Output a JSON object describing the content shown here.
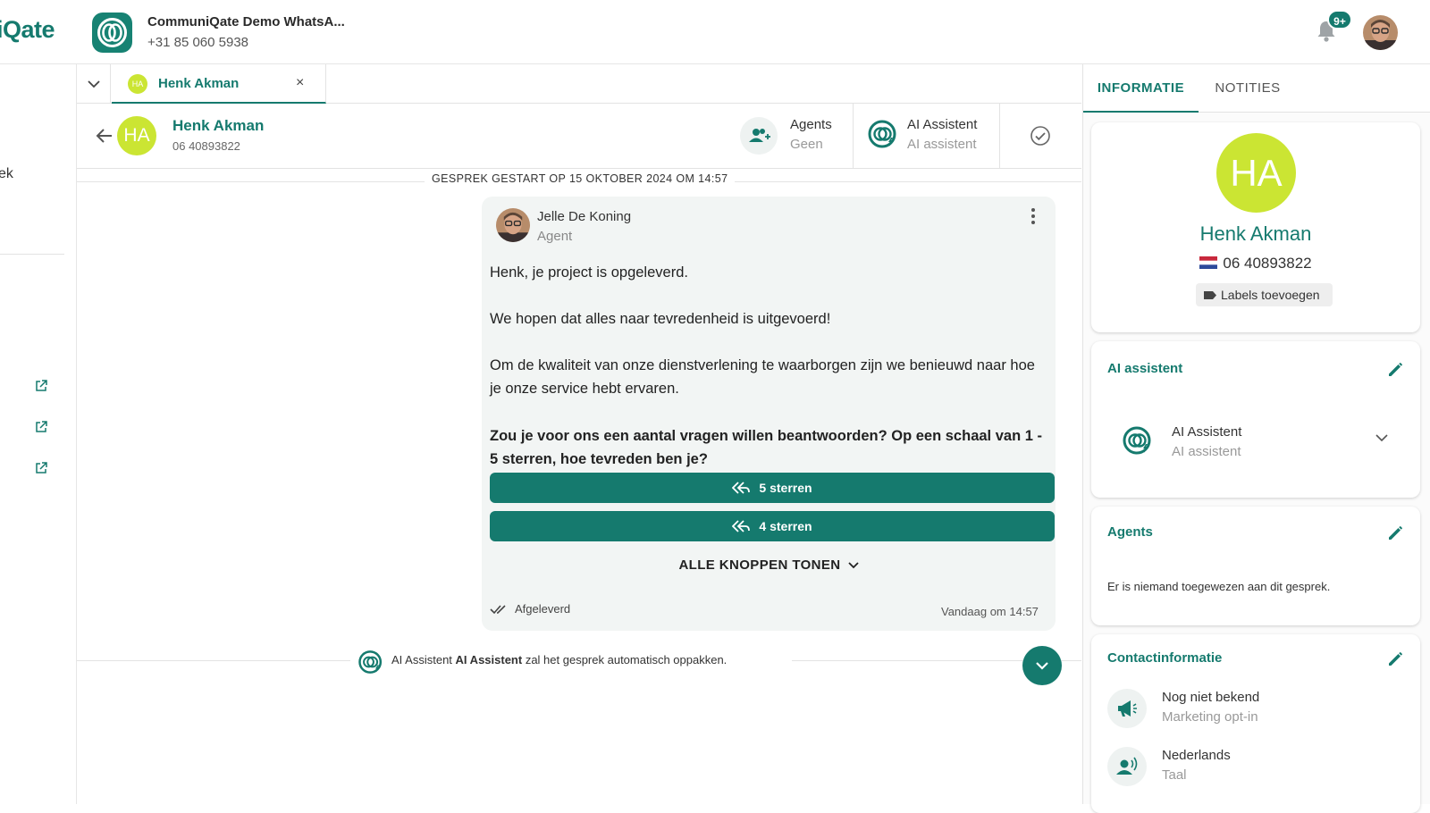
{
  "app": {
    "brand": "iQate"
  },
  "channel": {
    "name": "CommuniQate Demo WhatsA...",
    "phone": "+31 85 060 5938"
  },
  "notifications": {
    "badge": "9+"
  },
  "sidebar": {
    "partial_label": "ek"
  },
  "tabs": {
    "open_conversation": "Henk Akman",
    "close_symbol": "×",
    "mini_avatar": "HA"
  },
  "conversation": {
    "avatar": "HA",
    "name": "Henk Akman",
    "phone": "06 40893822",
    "agents_title": "Agents",
    "agents_value": "Geen",
    "ai_title": "AI Assistent",
    "ai_value": "AI assistent",
    "started": "GESPREK GESTART OP 15 OKTOBER 2024 OM 14:57"
  },
  "message": {
    "sender": "Jelle De Koning",
    "role": "Agent",
    "paragraphs": [
      "Henk, je project is opgeleverd.",
      "We hopen dat alles naar tevredenheid is uitgevoerd!",
      "Om de kwaliteit van onze dienstverlening te waarborgen zijn we benieuwd naar hoe je onze service hebt ervaren."
    ],
    "question": "Zou je voor ons een aantal vragen willen beantwoorden? Op een schaal van 1 - 5 sterren, hoe tevreden ben je?",
    "buttons": [
      "5 sterren",
      "4 sterren"
    ],
    "show_all": "ALLE KNOPPEN TONEN",
    "status": "Afgeleverd",
    "time": "Vandaag om 14:57"
  },
  "system_message": {
    "prefix": "AI Assistent",
    "bold": "AI Assistent",
    "suffix": "zal het gesprek automatisch oppakken."
  },
  "panel": {
    "tabs": [
      "INFORMATIE",
      "NOTITIES"
    ],
    "profile": {
      "avatar": "HA",
      "name": "Henk Akman",
      "phone": "06 40893822",
      "labels_button": "Labels toevoegen"
    },
    "ai_card": {
      "title": "AI assistent",
      "name": "AI Assistent",
      "sub": "AI assistent"
    },
    "agents_card": {
      "title": "Agents",
      "empty": "Er is niemand toegewezen aan dit gesprek."
    },
    "contact_card": {
      "title": "Contactinformatie",
      "items": [
        {
          "value": "Nog niet bekend",
          "label": "Marketing opt-in",
          "icon": "megaphone-icon"
        },
        {
          "value": "Nederlands",
          "label": "Taal",
          "icon": "speaking-person-icon"
        }
      ]
    }
  },
  "colors": {
    "accent": "#157a6e",
    "avatar_bg": "#cbe533",
    "bubble_bg": "#f2f5f4"
  }
}
